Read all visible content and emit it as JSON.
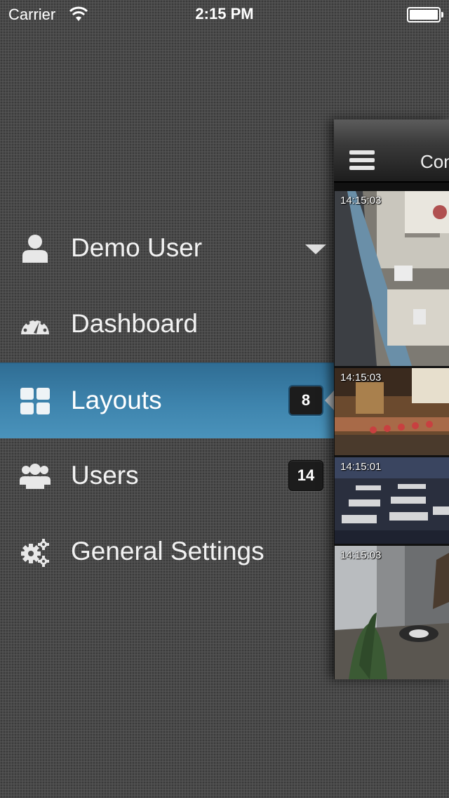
{
  "status_bar": {
    "carrier": "Carrier",
    "time": "2:15 PM",
    "wifi_icon": "wifi-icon",
    "battery_level": 100
  },
  "menu": {
    "items": [
      {
        "label": "Demo User",
        "icon": "user-icon",
        "badge": null
      },
      {
        "label": "Dashboard",
        "icon": "dashboard-gauge-icon",
        "badge": null
      },
      {
        "label": "Layouts",
        "icon": "grid-icon",
        "badge": "8",
        "active": true
      },
      {
        "label": "Users",
        "icon": "users-group-icon",
        "badge": "14"
      },
      {
        "label": "General Settings",
        "icon": "gears-icon",
        "badge": null
      }
    ]
  },
  "main_panel": {
    "title": "Con",
    "menu_icon": "hamburger-icon",
    "cameras": [
      {
        "timestamp": "14:15:03"
      },
      {
        "timestamp": "14:15:03"
      },
      {
        "timestamp": "14:15:01"
      },
      {
        "timestamp": "14:15:03"
      }
    ]
  },
  "colors": {
    "active_item": "#3e84ad",
    "badge_bg": "#1c1c1c",
    "background": "#4a4a4a"
  }
}
